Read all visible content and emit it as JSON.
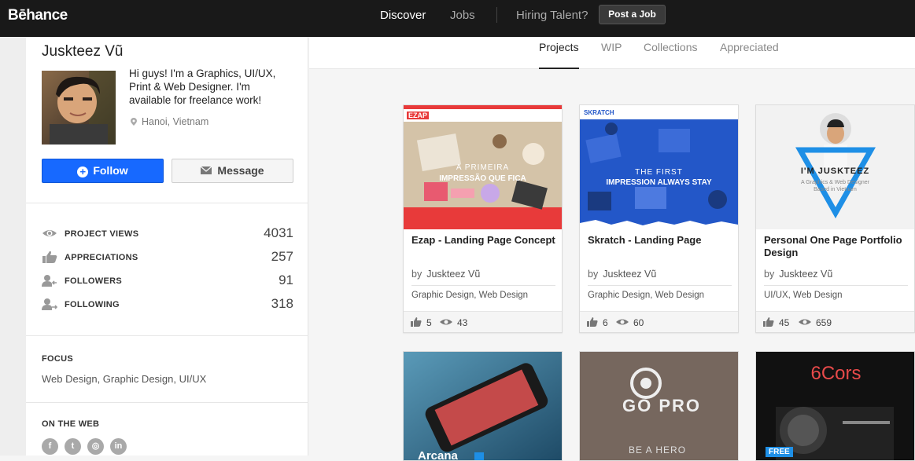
{
  "header": {
    "logo": "Bēhance",
    "nav": {
      "discover": "Discover",
      "jobs": "Jobs",
      "hiring": "Hiring Talent?"
    },
    "post_job": "Post a Job"
  },
  "profile": {
    "name": "Juskteez Vũ",
    "bio": "Hi guys! I'm a Graphics, UI/UX, Print & Web Designer. I'm available for freelance work!",
    "location": "Hanoi, Vietnam",
    "follow_label": "Follow",
    "message_label": "Message"
  },
  "stats": [
    {
      "label": "PROJECT VIEWS",
      "value": "4031",
      "icon": "eye-icon"
    },
    {
      "label": "APPRECIATIONS",
      "value": "257",
      "icon": "thumbs-up-icon"
    },
    {
      "label": "FOLLOWERS",
      "value": "91",
      "icon": "follower-icon"
    },
    {
      "label": "FOLLOWING",
      "value": "318",
      "icon": "following-icon"
    }
  ],
  "focus": {
    "title": "FOCUS",
    "text": "Web Design, Graphic Design, UI/UX"
  },
  "web": {
    "title": "ON THE WEB",
    "links": [
      "facebook-icon",
      "twitter-icon",
      "instagram-icon",
      "linkedin-icon"
    ],
    "glyphs": [
      "f",
      "t",
      "◎",
      "in"
    ]
  },
  "tabs": [
    "Projects",
    "WIP",
    "Collections",
    "Appreciated"
  ],
  "projects": [
    {
      "title": "Ezap - Landing Page Concept",
      "by": "by",
      "author": "Juskteez Vũ",
      "categories": "Graphic Design, Web Design",
      "likes": "5",
      "views": "43",
      "thumb_logo": "EZAP",
      "thumb_line1": "A PRIMEIRA",
      "thumb_line2": "IMPRESSÃO QUE FICA",
      "thumb_color": "#e83a3a"
    },
    {
      "title": "Skratch - Landing Page",
      "by": "by",
      "author": "Juskteez Vũ",
      "categories": "Graphic Design, Web Design",
      "likes": "6",
      "views": "60",
      "thumb_logo": "SKRATCH",
      "thumb_line1": "THE FIRST",
      "thumb_line2": "IMPRESSION ALWAYS STAY",
      "thumb_color": "#2357c8"
    },
    {
      "title": "Personal One Page Portfolio Design",
      "by": "by",
      "author": "Juskteez Vũ",
      "categories": "UI/UX, Web Design",
      "likes": "45",
      "views": "659",
      "thumb_line1": "I'M JUSKTEEZ",
      "thumb_line2": "A Graphics & Web Designer Based in Vietnam",
      "thumb_color": "#1e8fe6"
    }
  ],
  "row2": [
    {
      "caption": "Arcana",
      "color": "#2a6b8a"
    },
    {
      "caption": "BE A HERO",
      "mark": "GO PRO",
      "color": "#6a5a52"
    },
    {
      "caption": "6Cors",
      "badge": "FREE",
      "color": "#111111"
    }
  ]
}
